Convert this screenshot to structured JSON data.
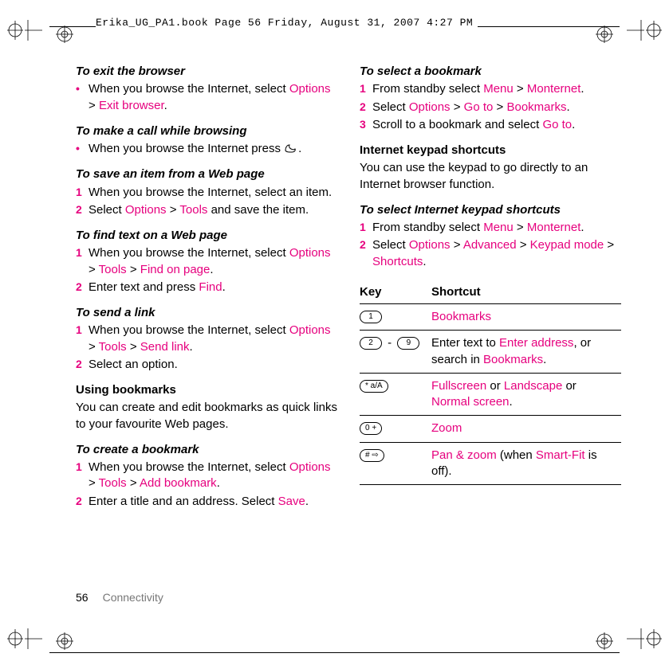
{
  "header": {
    "stamp": "Erika_UG_PA1.book  Page 56  Friday, August 31, 2007  4:27 PM"
  },
  "footer": {
    "page_number": "56",
    "section": "Connectivity"
  },
  "left": {
    "s1": {
      "title": "To exit the browser",
      "b1_a": "When you browse the Internet, select ",
      "b1_b": "Options",
      "b1_c": " > ",
      "b1_d": "Exit browser",
      "b1_e": "."
    },
    "s2": {
      "title": "To make a call while browsing",
      "b1_a": "When you browse the Internet press ",
      "b1_b": "."
    },
    "s3": {
      "title": "To save an item from a Web page",
      "n1": "1",
      "n1_t": "When you browse the Internet, select an item.",
      "n2": "2",
      "n2_a": "Select ",
      "n2_b": "Options",
      "n2_c": " > ",
      "n2_d": "Tools",
      "n2_e": " and save the item."
    },
    "s4": {
      "title": "To find text on a Web page",
      "n1": "1",
      "n1_a": "When you browse the Internet, select ",
      "n1_b": "Options",
      "n1_c": " > ",
      "n1_d": "Tools",
      "n1_e": " > ",
      "n1_f": "Find on page",
      "n1_g": ".",
      "n2": "2",
      "n2_a": "Enter text and press ",
      "n2_b": "Find",
      "n2_c": "."
    },
    "s5": {
      "title": "To send a link",
      "n1": "1",
      "n1_a": "When you browse the Internet, select ",
      "n1_b": "Options",
      "n1_c": " > ",
      "n1_d": "Tools",
      "n1_e": " > ",
      "n1_f": "Send link",
      "n1_g": ".",
      "n2": "2",
      "n2_t": "Select an option."
    },
    "s6": {
      "heading": "Using bookmarks",
      "para": "You can create and edit bookmarks as quick links to your favourite Web pages."
    },
    "s7": {
      "title": "To create a bookmark",
      "n1": "1",
      "n1_a": "When you browse the Internet, select ",
      "n1_b": "Options",
      "n1_c": " > ",
      "n1_d": "Tools",
      "n1_e": " > ",
      "n1_f": "Add bookmark",
      "n1_g": ".",
      "n2": "2",
      "n2_a": "Enter a title and an address. Select ",
      "n2_b": "Save",
      "n2_c": "."
    }
  },
  "right": {
    "s1": {
      "title": "To select a bookmark",
      "n1": "1",
      "n1_a": "From standby select ",
      "n1_b": "Menu",
      "n1_c": " > ",
      "n1_d": "Monternet",
      "n1_e": ".",
      "n2": "2",
      "n2_a": "Select ",
      "n2_b": "Options",
      "n2_c": " > ",
      "n2_d": "Go to",
      "n2_e": " > ",
      "n2_f": "Bookmarks",
      "n2_g": ".",
      "n3": "3",
      "n3_a": "Scroll to a bookmark and select ",
      "n3_b": "Go to",
      "n3_c": "."
    },
    "s2": {
      "heading": "Internet keypad shortcuts",
      "para": "You can use the keypad to go directly to an Internet browser function."
    },
    "s3": {
      "title": "To select Internet keypad shortcuts",
      "n1": "1",
      "n1_a": "From standby select ",
      "n1_b": "Menu",
      "n1_c": " > ",
      "n1_d": "Monternet",
      "n1_e": ".",
      "n2": "2",
      "n2_a": "Select ",
      "n2_b": "Options",
      "n2_c": " > ",
      "n2_d": "Advanced",
      "n2_e": " > ",
      "n2_f": "Keypad mode",
      "n2_g": " > ",
      "n2_h": "Shortcuts",
      "n2_i": "."
    },
    "table": {
      "h1": "Key",
      "h2": "Shortcut",
      "r1_key": "1",
      "r1_val": "Bookmarks",
      "r2_key_a": "2",
      "r2_key_dash": " - ",
      "r2_key_b": "9",
      "r2_a": "Enter text to ",
      "r2_b": "Enter address",
      "r2_c": ", or search in ",
      "r2_d": "Bookmarks",
      "r2_e": ".",
      "r3_key": "* a/A",
      "r3_a": "Fullscreen",
      "r3_b": " or ",
      "r3_c": "Landscape",
      "r3_d": " or ",
      "r3_e": "Normal screen",
      "r3_f": ".",
      "r4_key": "0 +",
      "r4_val": "Zoom",
      "r5_key": "# ⇨",
      "r5_a": "Pan & zoom",
      "r5_b": " (when ",
      "r5_c": "Smart-Fit",
      "r5_d": " is off)."
    }
  }
}
